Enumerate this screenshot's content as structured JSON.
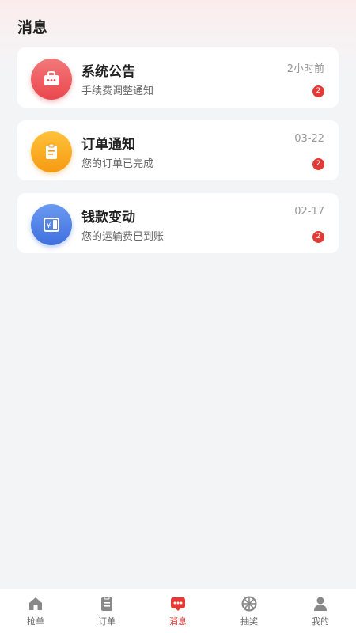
{
  "page": {
    "title": "消息"
  },
  "messages": [
    {
      "icon": "shop-icon",
      "color": "#ef5a5f",
      "title": "系统公告",
      "subtitle": "手续费调整通知",
      "time": "2小时前",
      "badge": "2"
    },
    {
      "icon": "clipboard-icon",
      "color": "#f6a623",
      "title": "订单通知",
      "subtitle": "您的订单已完成",
      "time": "03-22",
      "badge": "2"
    },
    {
      "icon": "wallet-icon",
      "color": "#4a7ee6",
      "title": "钱款变动",
      "subtitle": "您的运输费已到账",
      "time": "02-17",
      "badge": "2"
    }
  ],
  "tabbar": {
    "active_color": "#e53935",
    "items": [
      {
        "icon": "home-icon",
        "label": "抢单",
        "active": false
      },
      {
        "icon": "clipboard-icon",
        "label": "订单",
        "active": false
      },
      {
        "icon": "chat-icon",
        "label": "消息",
        "active": true
      },
      {
        "icon": "wheel-icon",
        "label": "抽奖",
        "active": false
      },
      {
        "icon": "user-icon",
        "label": "我的",
        "active": false
      }
    ]
  }
}
